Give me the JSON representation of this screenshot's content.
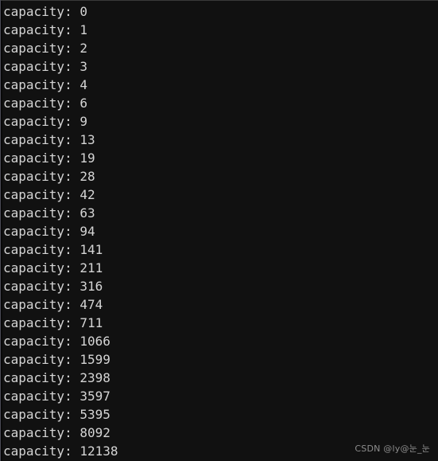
{
  "window": {
    "kind": "terminal-console-output",
    "background_color": "#111111",
    "text_color": "#d5d5d5",
    "border_color": "#4a4a55"
  },
  "console": {
    "label_prefix": "capacity: ",
    "lines": [
      "capacity: 0",
      "capacity: 1",
      "capacity: 2",
      "capacity: 3",
      "capacity: 4",
      "capacity: 6",
      "capacity: 9",
      "capacity: 13",
      "capacity: 19",
      "capacity: 28",
      "capacity: 42",
      "capacity: 63",
      "capacity: 94",
      "capacity: 141",
      "capacity: 211",
      "capacity: 316",
      "capacity: 474",
      "capacity: 711",
      "capacity: 1066",
      "capacity: 1599",
      "capacity: 2398",
      "capacity: 3597",
      "capacity: 5395",
      "capacity: 8092",
      "capacity: 12138"
    ],
    "values": [
      0,
      1,
      2,
      3,
      4,
      6,
      9,
      13,
      19,
      28,
      42,
      63,
      94,
      141,
      211,
      316,
      474,
      711,
      1066,
      1599,
      2398,
      3597,
      5395,
      8092,
      12138
    ]
  },
  "watermark": {
    "text": "CSDN @ly@눈_눈"
  }
}
